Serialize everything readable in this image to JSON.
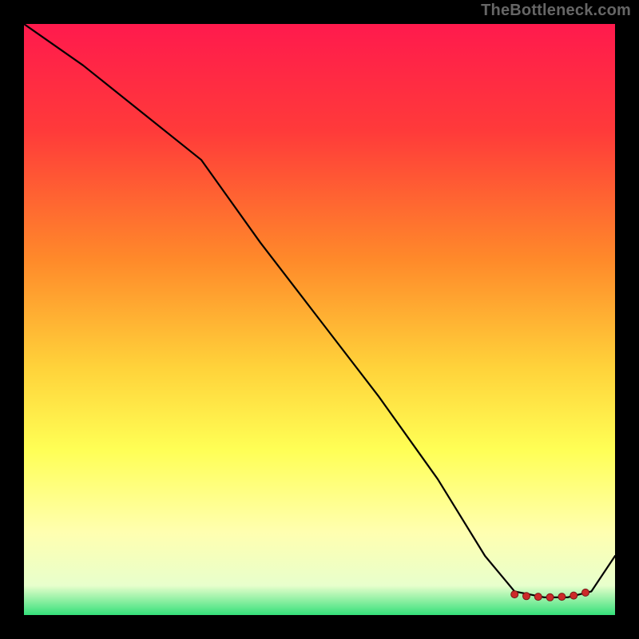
{
  "watermark": "TheBottleneck.com",
  "chart_data": {
    "type": "line",
    "title": "",
    "xlabel": "",
    "ylabel": "",
    "xlim": [
      0,
      100
    ],
    "ylim": [
      0,
      100
    ],
    "gradient_stops": [
      {
        "offset": 0,
        "color": "#ff1a4d"
      },
      {
        "offset": 18,
        "color": "#ff3a3a"
      },
      {
        "offset": 40,
        "color": "#ff8a2a"
      },
      {
        "offset": 58,
        "color": "#ffd23a"
      },
      {
        "offset": 72,
        "color": "#ffff55"
      },
      {
        "offset": 86,
        "color": "#ffffb0"
      },
      {
        "offset": 95,
        "color": "#e8ffcc"
      },
      {
        "offset": 100,
        "color": "#35e07a"
      }
    ],
    "series": [
      {
        "name": "bottleneck-curve",
        "x": [
          0,
          10,
          20,
          30,
          40,
          50,
          60,
          70,
          78,
          83,
          88,
          92,
          96,
          100
        ],
        "values": [
          100,
          93,
          85,
          77,
          63,
          50,
          37,
          23,
          10,
          4,
          3,
          3,
          4,
          10
        ]
      }
    ],
    "highlight_points": {
      "name": "optimal-zone",
      "x": [
        83,
        85,
        87,
        89,
        91,
        93,
        95
      ],
      "values": [
        3.5,
        3.2,
        3.1,
        3.0,
        3.1,
        3.3,
        3.8
      ]
    }
  }
}
